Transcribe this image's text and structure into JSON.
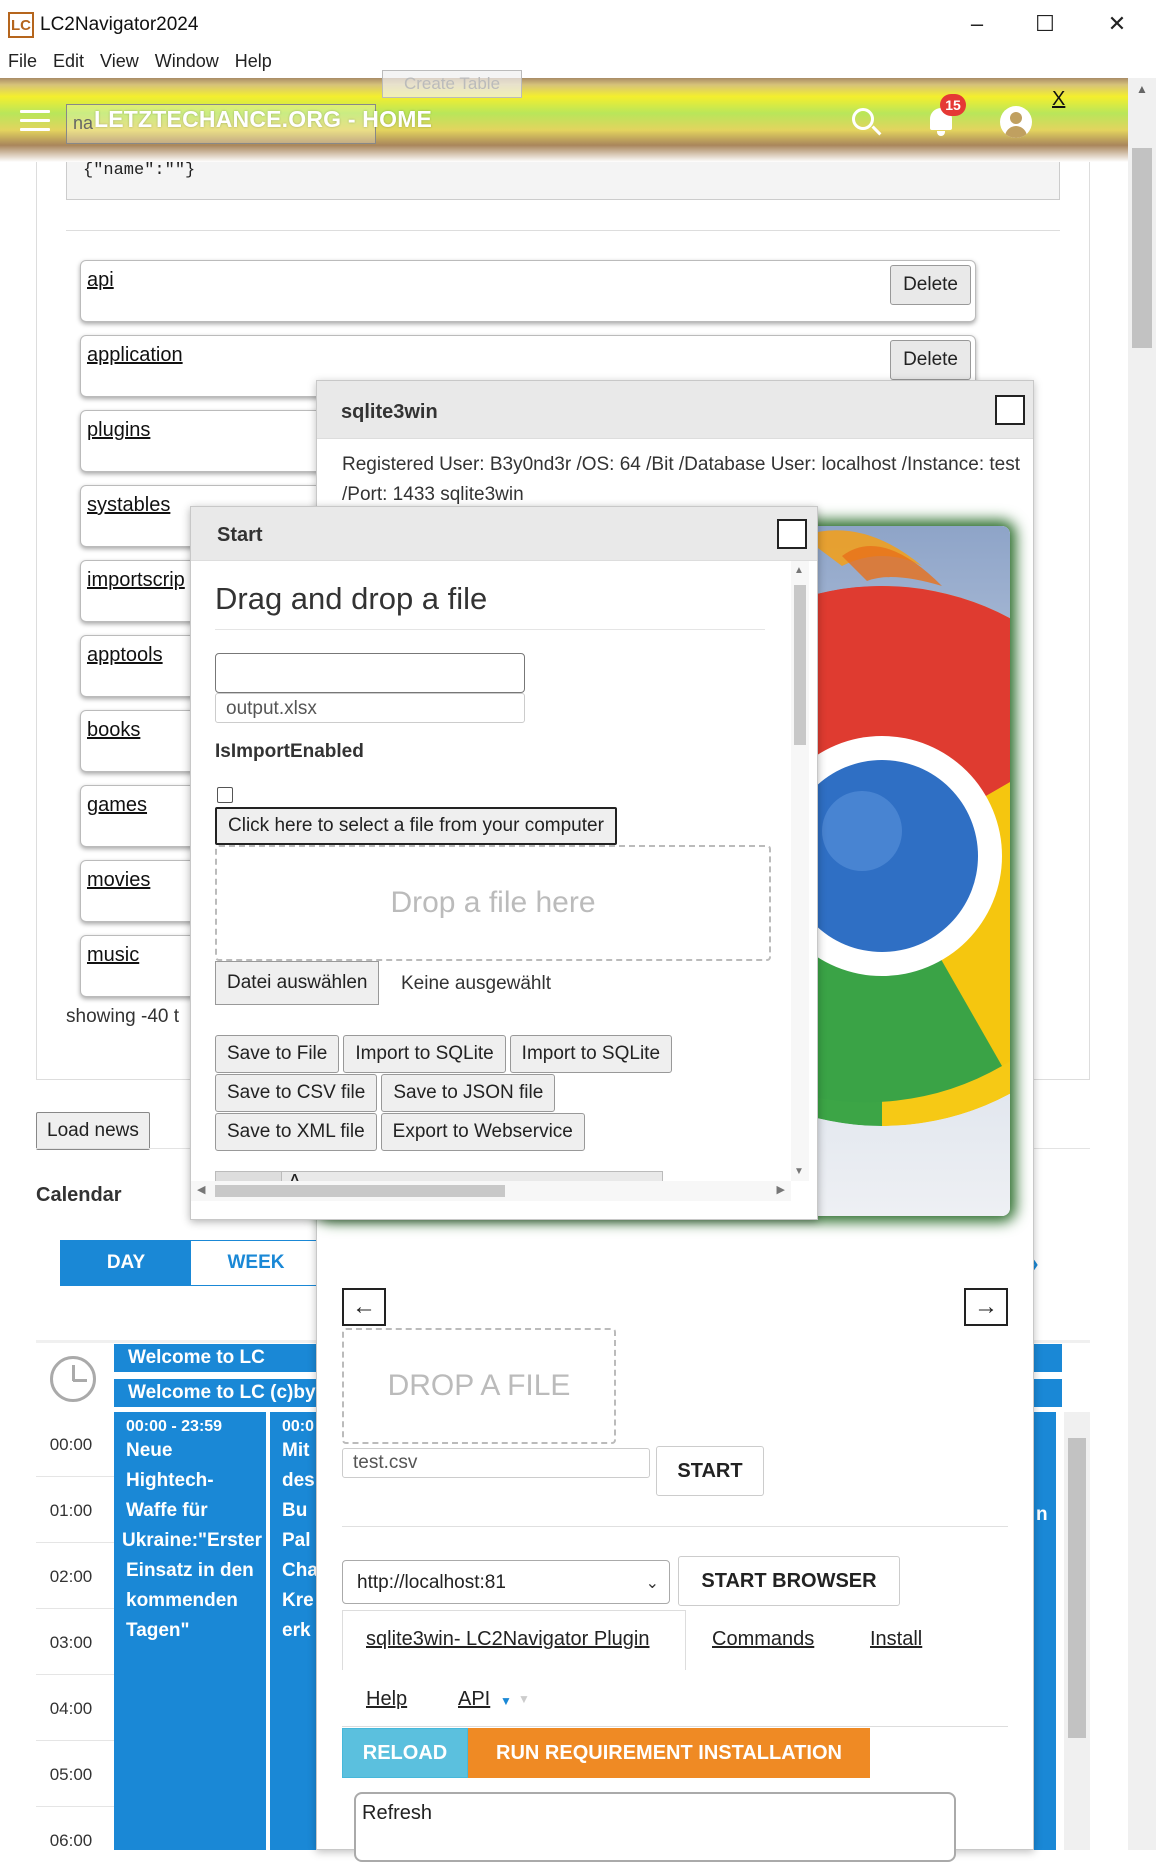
{
  "window": {
    "logo_text": "LC",
    "title": "LC2Navigator2024",
    "minimize": "–",
    "maximize": "☐",
    "close": "✕"
  },
  "menu": [
    "File",
    "Edit",
    "View",
    "Window",
    "Help"
  ],
  "header": {
    "brand": "LETZTECHANCE.ORG - HOME",
    "notification_count": "15",
    "close_label": "X",
    "ghost_create_label": "Create Table",
    "ghost_field_text": "na"
  },
  "page": {
    "json_text": "{\"name\":\"\"}",
    "tables": [
      {
        "name": "api",
        "delete_label": "Delete"
      },
      {
        "name": "application",
        "delete_label": "Delete"
      },
      {
        "name": "plugins"
      },
      {
        "name": "systables"
      },
      {
        "name": "importscrip"
      },
      {
        "name": "apptools"
      },
      {
        "name": "books"
      },
      {
        "name": "games"
      },
      {
        "name": "movies"
      },
      {
        "name": "music"
      }
    ],
    "showing_text": "showing -40 t",
    "load_news_label": "Load news"
  },
  "calendar": {
    "title": "Calendar",
    "tabs": [
      "DAY",
      "WEEK"
    ],
    "next_icon": "›",
    "allday_events": [
      "Welcome to LC",
      "Welcome to LC (c)by"
    ],
    "hours": [
      "00:00",
      "01:00",
      "02:00",
      "03:00",
      "04:00",
      "05:00",
      "06:00"
    ],
    "event1": {
      "time": "00:00 - 23:59",
      "lines": [
        "Neue",
        "Hightech-",
        "Waffe für",
        "Ukraine:\"Erster",
        "Einsatz in den",
        "kommenden",
        "Tagen\""
      ]
    },
    "event2": {
      "time": "00:0",
      "lines": [
        "Mit",
        "des",
        "Bu",
        "Pal",
        "Cha",
        "Kre",
        "erk"
      ]
    },
    "edge_fragment": "n"
  },
  "sqlite_window": {
    "title": "sqlite3win",
    "registered_info": "Registered User: B3y0nd3r /OS: 64 /Bit /Database User: localhost /Instance: test /Port: 1433 sqlite3win",
    "prev_arrow": "←",
    "next_arrow": "→",
    "drop_label": "DROP A FILE",
    "csv_value": "test.csv",
    "start_label": "START",
    "url_value": "http://localhost:81",
    "start_browser_label": "START BROWSER",
    "tabs": [
      "sqlite3win- LC2Navigator Plugin",
      "Commands",
      "Install",
      "Help",
      "API"
    ],
    "reload_label": "RELOAD",
    "run_label": "RUN REQUIREMENT INSTALLATION",
    "refresh_text": "Refresh",
    "colors": {
      "reload": "#5bc0de",
      "run": "#ef8a24"
    }
  },
  "start_window": {
    "title": "Start",
    "heading": "Drag and drop a file",
    "output_value": "output.xlsx",
    "import_label": "IsImportEnabled",
    "select_file_label": "Click here to select a file from your computer",
    "drop_here_label": "Drop a file here",
    "choose_file_label": "Datei auswählen",
    "no_file_label": "Keine ausgewählt",
    "buttons_row1": [
      "Save to File",
      "Import to SQLite",
      "Import to SQLite"
    ],
    "buttons_row2": [
      "Save to CSV file",
      "Save to JSON file"
    ],
    "buttons_row3": [
      "Save to XML file",
      "Export to Webservice"
    ],
    "grid_cell": "A"
  },
  "colors": {
    "accent": "#1a88d6",
    "badge": "#e53935"
  }
}
